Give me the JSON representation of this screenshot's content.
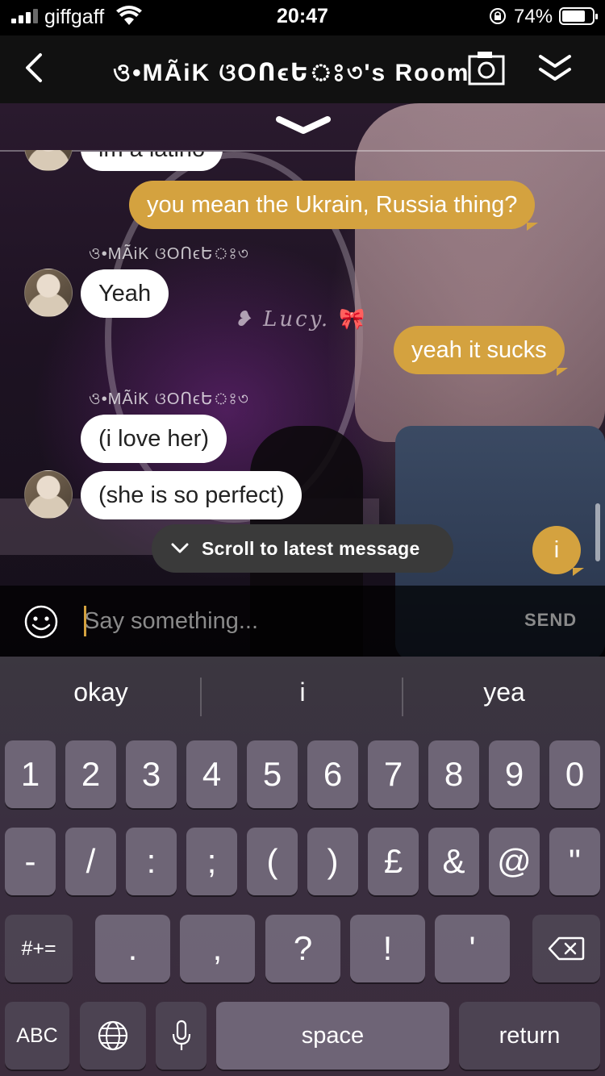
{
  "status_bar": {
    "carrier": "giffgaff",
    "time": "20:47",
    "battery_pct": "74%",
    "icons": [
      "signal-icon",
      "wifi-icon",
      "rotation-lock-icon",
      "battery-icon"
    ]
  },
  "header": {
    "title": "ও•MÃiK ଓOՈϵԵঃ৩'s Room",
    "icons": [
      "back-chevron-icon",
      "camera-icon",
      "double-chevron-down-icon"
    ]
  },
  "chat": {
    "partial_message": "im a latino",
    "messages": [
      {
        "sender": "",
        "text": "you mean the Ukrain, Russia thing?",
        "direction": "out"
      },
      {
        "sender": "ও•MÃiK ଓOՈϵԵঃ৩",
        "text": "Yeah",
        "direction": "in"
      },
      {
        "sender": "",
        "text": "yeah it sucks",
        "direction": "out"
      },
      {
        "sender": "ও•MÃiK ଓOՈϵԵঃ৩",
        "text": "(i love her)",
        "direction": "in"
      },
      {
        "sender": "",
        "text": "(she is so perfect)",
        "direction": "in"
      },
      {
        "sender": "",
        "text": "i",
        "direction": "out"
      }
    ],
    "scene_sign": "Lucy.",
    "scroll_latest_label": "Scroll to latest message"
  },
  "composer": {
    "placeholder": "Say something...",
    "send_label": "SEND",
    "emoji_icon": "smiley-icon"
  },
  "keyboard": {
    "suggestions": [
      "okay",
      "i",
      "yea"
    ],
    "row1": [
      "1",
      "2",
      "3",
      "4",
      "5",
      "6",
      "7",
      "8",
      "9",
      "0"
    ],
    "row2": [
      "-",
      "/",
      ":",
      ";",
      "(",
      ")",
      "£",
      "&",
      "@",
      "\""
    ],
    "shift_label": "#+=",
    "row3": [
      ".",
      ",",
      "?",
      "!",
      "'"
    ],
    "abc_label": "ABC",
    "space_label": "space",
    "return_label": "return",
    "icons": [
      "delete-icon",
      "globe-icon",
      "microphone-icon"
    ]
  }
}
